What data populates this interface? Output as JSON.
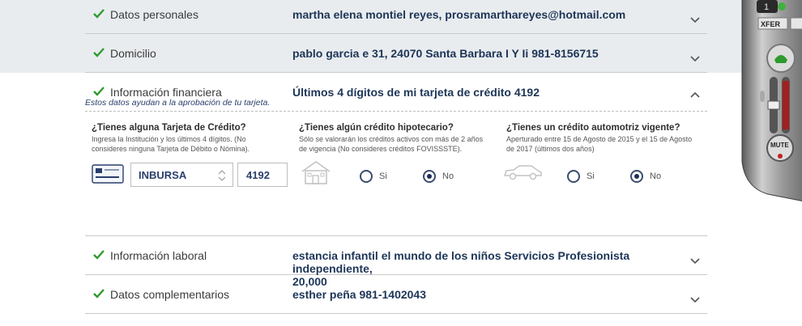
{
  "sections": [
    {
      "title": "Datos personales",
      "summary": "martha elena montiel reyes, prosramarthareyes@hotmail.com"
    },
    {
      "title": "Domicilio",
      "summary": "pablo garcia e 31, 24070 Santa Barbara I Y Ii 981-8156715"
    },
    {
      "title": "Información financiera",
      "summary": "Últimos 4 dígitos de mi tarjeta de crédito 4192",
      "hint": "Estos datos ayudan a la aprobación de tu tarjeta."
    },
    {
      "title": "Información laboral",
      "summary_line1": "estancia infantil el mundo de los niños Servicios Profesionista independiente,",
      "summary_line2": "20,000"
    },
    {
      "title": "Datos complementarios",
      "summary": "esther peña 981-1402043"
    }
  ],
  "financial": {
    "card": {
      "question": "¿Tienes alguna Tarjeta de Crédito?",
      "desc": "Ingresa la Institución y los últimos 4 dígitos. (No consideres ninguna Tarjeta de Débito o Nómina).",
      "institution": "INBURSA",
      "last_digits": "4192"
    },
    "mortgage": {
      "question": "¿Tienes algún crédito hipotecario?",
      "desc": "Sólo se valorarán los créditos activos con más de 2 años de vigencia (No consideres créditos FOVISSSTE).",
      "yes_label": "Si",
      "no_label": "No",
      "selected": "No"
    },
    "auto": {
      "question": "¿Tienes un crédito automotriz vigente?",
      "desc": "Aperturado entre 15 de Agosto de 2015 y el 15 de Agosto de 2017 (últimos dos años)",
      "yes_label": "Si",
      "no_label": "No",
      "selected": "No"
    }
  },
  "phone_widget": {
    "xfer_label": "XFER",
    "mute_label": "MUTE",
    "line_label": "1"
  },
  "colors": {
    "accent": "#1d3557",
    "check": "#2e9b2e",
    "band": "#e9ecef"
  }
}
